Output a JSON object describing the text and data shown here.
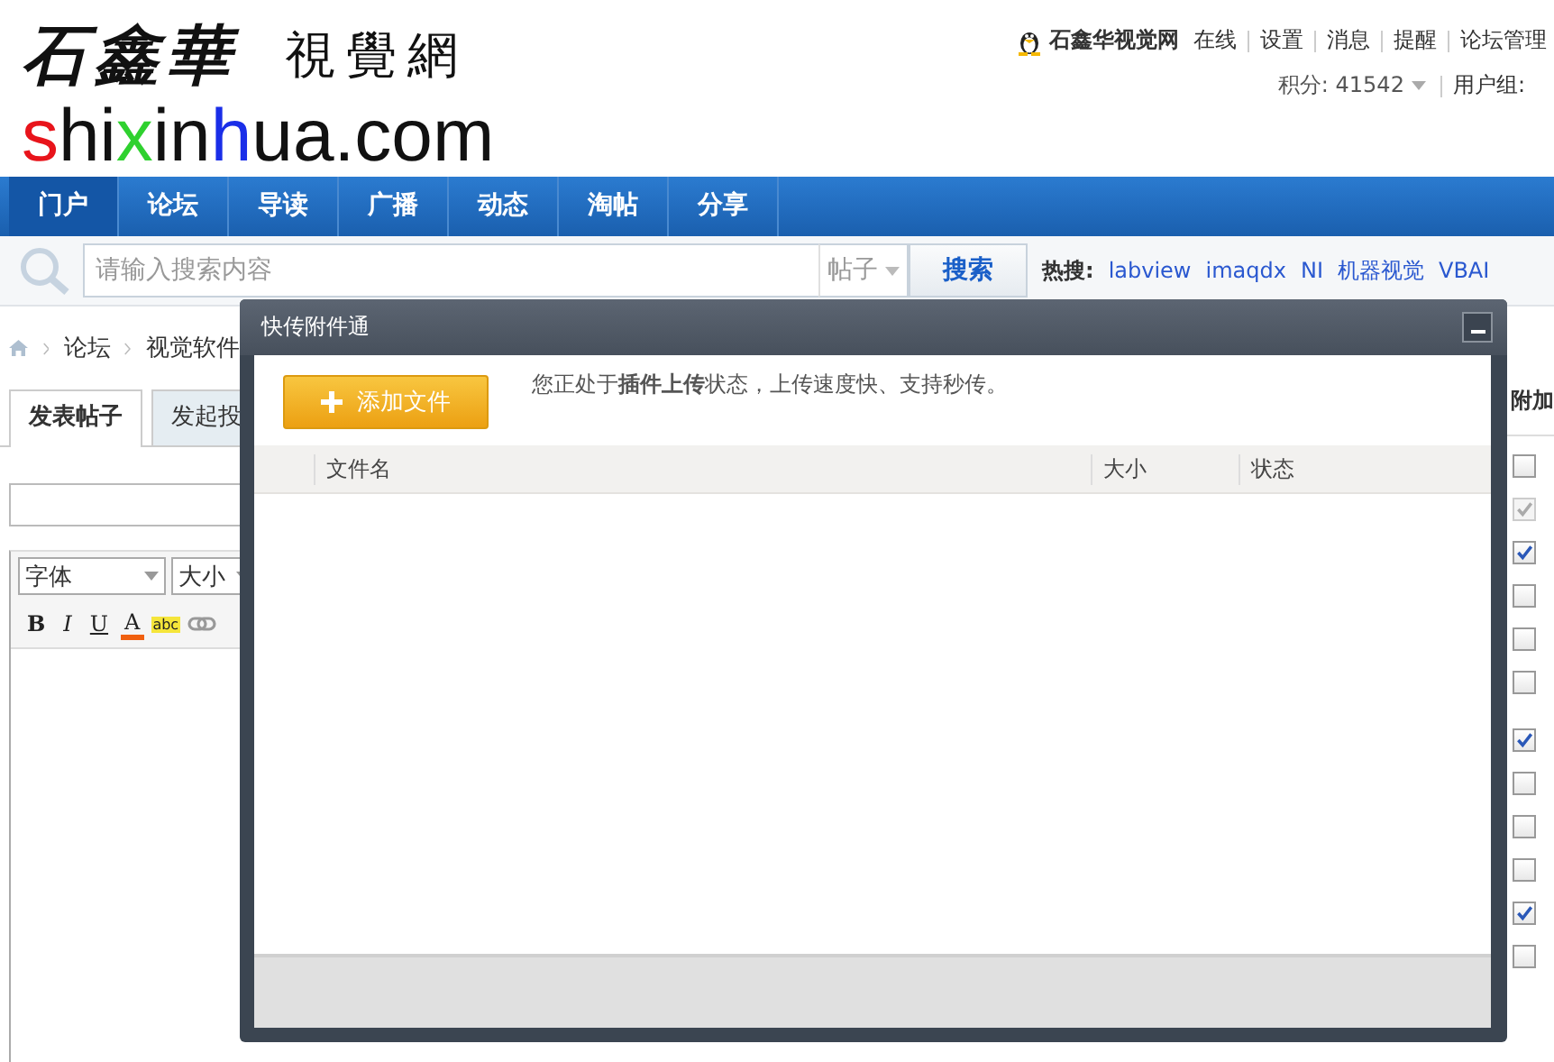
{
  "logo": {
    "calligraphy": "石鑫華",
    "seal": "視覺網",
    "domain": [
      {
        "text": "s",
        "color": "#e8141b"
      },
      {
        "text": "hi",
        "color": "#111111"
      },
      {
        "text": "x",
        "color": "#2fd12f"
      },
      {
        "text": "in",
        "color": "#111111"
      },
      {
        "text": "h",
        "color": "#1a2ee8"
      },
      {
        "text": "ua.com",
        "color": "#111111"
      }
    ]
  },
  "user_bar": {
    "site": "石鑫华视觉网",
    "status": "在线",
    "links": [
      "设置",
      "消息",
      "提醒",
      "论坛管理"
    ],
    "points": "积分: 41542",
    "group": "用户组:"
  },
  "nav": [
    {
      "label": "门户",
      "selected": true
    },
    {
      "label": "论坛",
      "selected": false
    },
    {
      "label": "导读",
      "selected": false
    },
    {
      "label": "广播",
      "selected": false
    },
    {
      "label": "动态",
      "selected": false
    },
    {
      "label": "淘帖",
      "selected": false
    },
    {
      "label": "分享",
      "selected": false
    }
  ],
  "search": {
    "placeholder": "请输入搜索内容",
    "scope": "帖子",
    "button": "搜索",
    "hot_label": "热搜:",
    "hot_links": [
      "labview",
      "imaqdx",
      "NI",
      "机器视觉",
      "VBAI"
    ]
  },
  "breadcrumb": [
    "论坛",
    "视觉软件"
  ],
  "post_tabs": [
    {
      "label": "发表帖子",
      "selected": true
    },
    {
      "label": "发起投",
      "selected": false
    }
  ],
  "editor": {
    "font_select": "字体",
    "size_select": "大小",
    "tools": [
      {
        "kind": "bold",
        "label": "B"
      },
      {
        "kind": "italic",
        "label": "I"
      },
      {
        "kind": "underline",
        "label": "U"
      },
      {
        "kind": "color",
        "label": "A"
      },
      {
        "kind": "highlight",
        "label": "abc"
      },
      {
        "kind": "link"
      }
    ]
  },
  "dialog": {
    "title": "快传附件通",
    "add_button": "添加文件",
    "notice": "您正处于**插件上传**状态，上传速度快、支持秒传。",
    "columns": [
      "文件名",
      "大小",
      "状态"
    ]
  },
  "sidebar": {
    "title": "附加",
    "options": [
      {
        "checked": false,
        "disabled": false
      },
      {
        "checked": true,
        "disabled": true
      },
      {
        "checked": true,
        "disabled": false
      },
      {
        "checked": false,
        "disabled": false
      },
      {
        "checked": false,
        "disabled": false
      },
      {
        "checked": false,
        "disabled": false
      },
      {
        "checked": true,
        "disabled": false
      },
      {
        "checked": false,
        "disabled": false
      },
      {
        "checked": false,
        "disabled": false
      },
      {
        "checked": false,
        "disabled": false
      },
      {
        "checked": true,
        "disabled": false
      },
      {
        "checked": false,
        "disabled": false
      }
    ]
  }
}
